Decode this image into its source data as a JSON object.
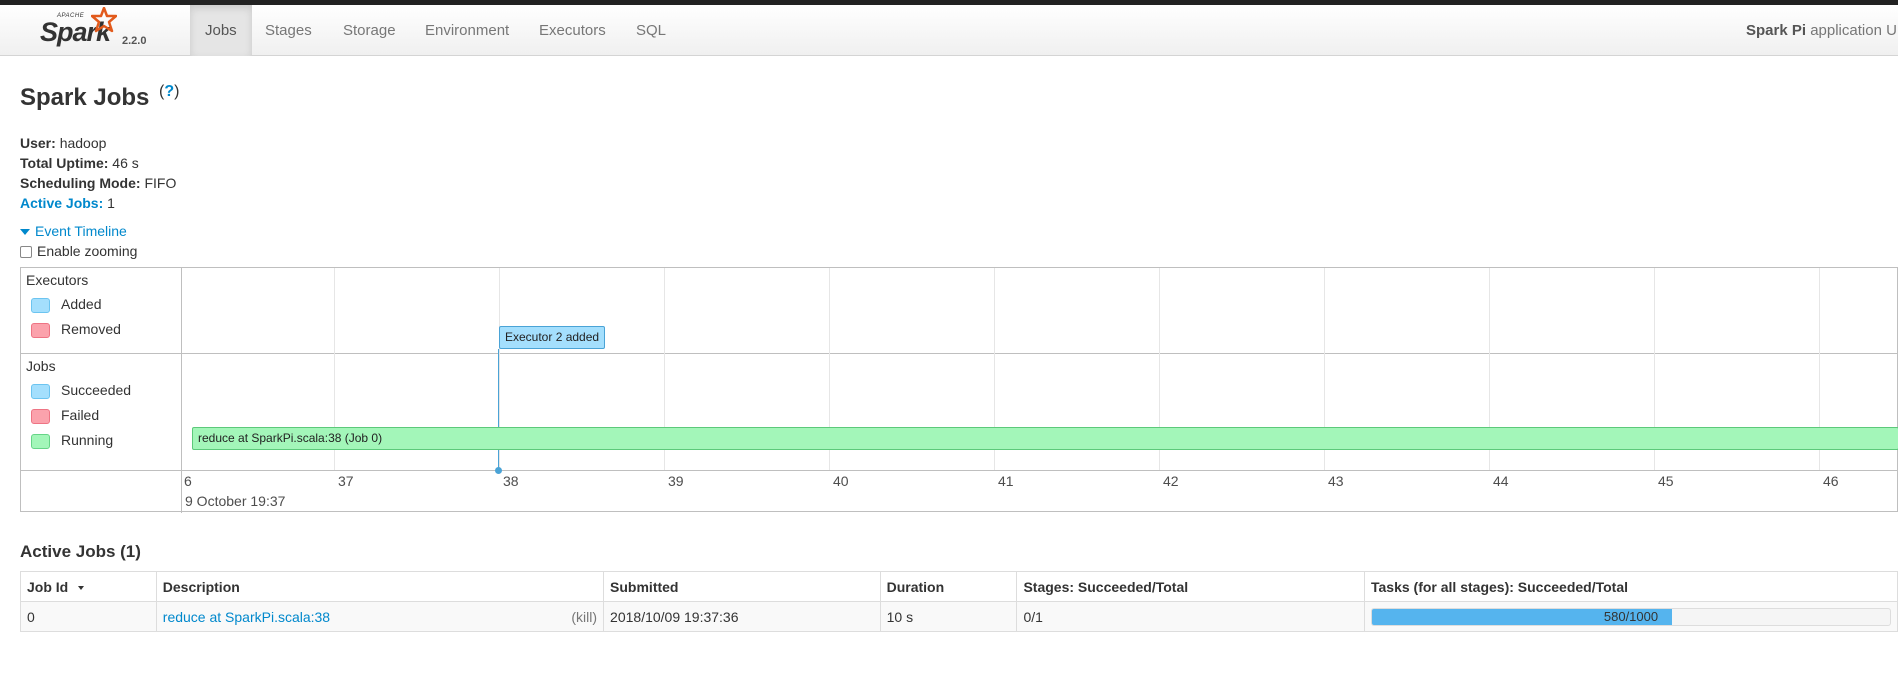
{
  "brand": {
    "apache": "APACHE",
    "name": "Spark",
    "version": "2.2.0"
  },
  "nav": {
    "tabs": [
      {
        "label": "Jobs",
        "active": true
      },
      {
        "label": "Stages"
      },
      {
        "label": "Storage"
      },
      {
        "label": "Environment"
      },
      {
        "label": "Executors"
      },
      {
        "label": "SQL"
      }
    ],
    "app_name_bold": "Spark Pi",
    "app_name_suffix": " application UI"
  },
  "page": {
    "title": "Spark Jobs",
    "help_open": "(",
    "help_link": "?",
    "help_close": ")"
  },
  "summary": {
    "user_label": "User:",
    "user": "hadoop",
    "uptime_label": "Total Uptime:",
    "uptime": "46 s",
    "mode_label": "Scheduling Mode:",
    "mode": "FIFO",
    "active_label": "Active Jobs:",
    "active": "1"
  },
  "timeline": {
    "toggle_label": "Event Timeline",
    "zoom_label": "Enable zooming",
    "executors_title": "Executors",
    "executor_legend": [
      "Added",
      "Removed"
    ],
    "jobs_title": "Jobs",
    "job_legend": [
      "Succeeded",
      "Failed",
      "Running"
    ],
    "axis_ticks": [
      "6",
      "37",
      "38",
      "39",
      "40",
      "41",
      "42",
      "43",
      "44",
      "45",
      "46"
    ],
    "axis_date": "9 October 19:37",
    "executor_event": "Executor 2 added",
    "job_event": "reduce at SparkPi.scala:38 (Job 0)"
  },
  "active_jobs": {
    "title": "Active Jobs (1)",
    "columns": [
      "Job Id",
      "Description",
      "Submitted",
      "Duration",
      "Stages: Succeeded/Total",
      "Tasks (for all stages): Succeeded/Total"
    ],
    "rows": [
      {
        "job_id": "0",
        "description": "reduce at SparkPi.scala:38",
        "kill": "(kill)",
        "submitted": "2018/10/09 19:37:36",
        "duration": "10 s",
        "stages": "0/1",
        "tasks": "580/1000",
        "tasks_fraction": 0.58
      }
    ]
  },
  "colors": {
    "accent": "#0088cc",
    "running": "#a3f6b9",
    "added": "#a4dffd",
    "removed": "#fba2ac",
    "progress": "#55b4ee"
  }
}
